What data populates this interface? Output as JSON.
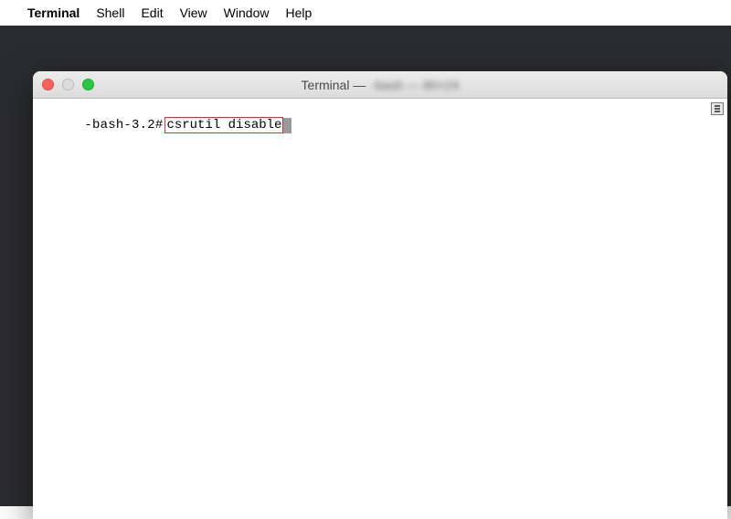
{
  "menubar": {
    "app_name": "Terminal",
    "items": [
      "Shell",
      "Edit",
      "View",
      "Window",
      "Help"
    ]
  },
  "window": {
    "title_prefix": "Terminal —",
    "title_obscured": "-bash — 80×24"
  },
  "terminal": {
    "prompt": "-bash-3.2#",
    "command": "csrutil disable"
  }
}
